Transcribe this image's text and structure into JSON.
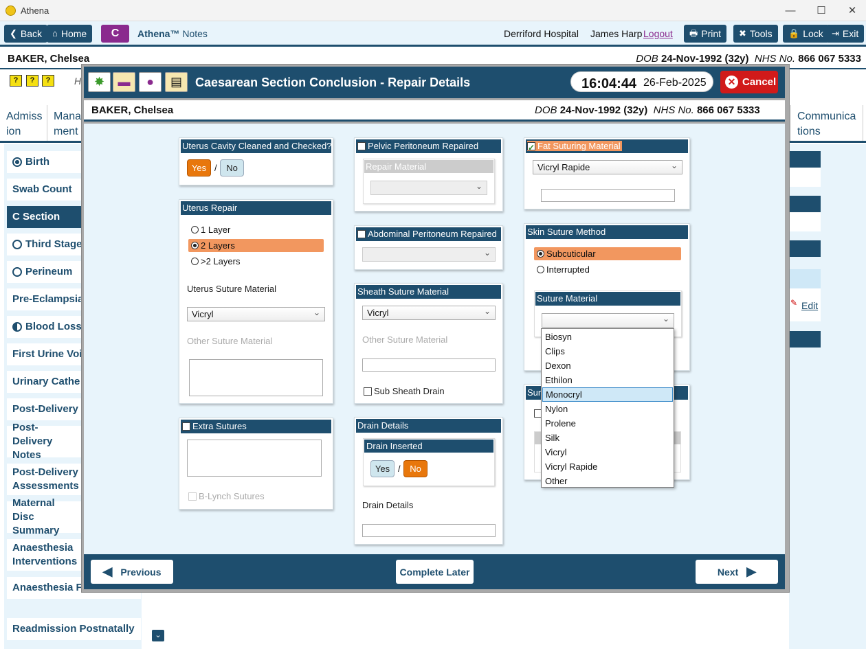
{
  "window": {
    "title": "Athena"
  },
  "nav": {
    "back": "Back",
    "home": "Home",
    "badge": "C",
    "app_brand": "Athena™",
    "app_suffix": " Notes",
    "hospital": "Derriford Hospital",
    "user": "James Harp",
    "logout": "Logout",
    "print": "Print",
    "tools": "Tools",
    "lock": "Lock",
    "exit": "Exit"
  },
  "patient": {
    "name": "BAKER, Chelsea",
    "dob_label": "DOB",
    "dob": "24-Nov-1992 (32y)",
    "nhs_label": "NHS No.",
    "nhs": "866 067 5333"
  },
  "background": {
    "tabs": [
      "Admiss ion",
      "Mana ment",
      "Communica tions"
    ],
    "sidebar": [
      "Birth",
      "Swab Count",
      "C Section",
      "Third Stage",
      "Perineum",
      "Pre-Eclampsia",
      "Blood Loss",
      "First Urine Voi",
      "Urinary Cathe",
      "Post-Delivery",
      "Post-Delivery Notes",
      "Post-Delivery Assessments",
      "Maternal Disc Summary",
      "Anaesthesia Interventions",
      "Anaesthesia Fo",
      "Readmission Postnatally"
    ],
    "right_edit": "Edit",
    "h_label": "H"
  },
  "modal": {
    "title": "Caesarean Section Conclusion - Repair Details",
    "time": "16:04:44",
    "date": "26-Feb-2025",
    "cancel": "Cancel",
    "uterus_cavity": {
      "header": "Uterus Cavity Cleaned and Checked?",
      "yes": "Yes",
      "sep": "/",
      "no": "No",
      "selected": "Yes"
    },
    "uterus_repair": {
      "header": "Uterus Repair",
      "options": [
        "1 Layer",
        "2 Layers",
        ">2 Layers"
      ],
      "selected": "2 Layers",
      "material_label": "Uterus Suture Material",
      "material_value": "Vicryl",
      "other_label": "Other Suture Material"
    },
    "extra_sutures": {
      "header": "Extra Sutures",
      "blynch": "B-Lynch Sutures"
    },
    "pelvic": {
      "header": "Pelvic Peritoneum Repaired",
      "repair_material": "Repair Material"
    },
    "abdominal": {
      "header": "Abdominal Peritoneum Repaired"
    },
    "sheath": {
      "header": "Sheath Suture Material",
      "value": "Vicryl",
      "other_label": "Other Suture Material",
      "drain": "Sub Sheath Drain"
    },
    "drain": {
      "header": "Drain Details",
      "inserted_header": "Drain Inserted",
      "yes": "Yes",
      "sep": "/",
      "no": "No",
      "selected": "No",
      "details_label": "Drain Details"
    },
    "fat": {
      "header": "Fat Suturing Material",
      "value": "Vicryl Rapide"
    },
    "skin": {
      "header": "Skin Suture Method",
      "options": [
        "Subcuticular",
        "Interrupted"
      ],
      "selected": "Subcuticular",
      "material_header": "Suture Material",
      "material_value": ""
    },
    "hidden_card": {
      "header_fragment": "Sur"
    },
    "dropdown": {
      "options": [
        "Biosyn",
        "Clips",
        "Dexon",
        "Ethilon",
        "Monocryl",
        "Nylon",
        "Prolene",
        "Silk",
        "Vicryl",
        "Vicryl Rapide",
        "Other"
      ],
      "hovered": "Monocryl"
    },
    "footer": {
      "previous": "Previous",
      "complete_later": "Complete Later",
      "next": "Next"
    }
  },
  "colors": {
    "navy": "#1e4e6e",
    "orange": "#e8770c",
    "highlight": "#f2975f",
    "purple": "#8a2a8e",
    "cancel_red": "#d11a1a"
  }
}
